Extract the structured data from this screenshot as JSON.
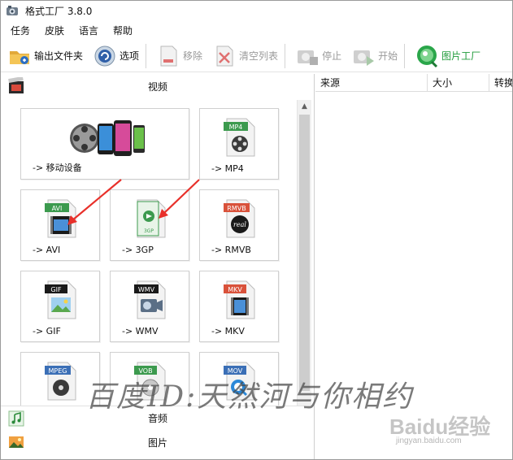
{
  "window": {
    "title": "格式工厂 3.8.0"
  },
  "menu": [
    "任务",
    "皮肤",
    "语言",
    "帮助"
  ],
  "toolbar": {
    "output_folder": "输出文件夹",
    "options": "选项",
    "remove": "移除",
    "clear_list": "清空列表",
    "stop": "停止",
    "start": "开始",
    "picture_factory": "图片工厂"
  },
  "categories": {
    "video": "视频",
    "audio": "音频",
    "picture": "图片"
  },
  "video_tiles": {
    "mobile": {
      "label": "-> 移动设备"
    },
    "mp4": {
      "label": "-> MP4",
      "badge": "MP4"
    },
    "avi": {
      "label": "-> AVI",
      "badge": "AVI"
    },
    "gp3": {
      "label": "-> 3GP",
      "badge": "3GP"
    },
    "rmvb": {
      "label": "-> RMVB",
      "badge": "RMVB",
      "sub": "real"
    },
    "gif": {
      "label": "-> GIF",
      "badge": "GIF"
    },
    "wmv": {
      "label": "-> WMV",
      "badge": "WMV"
    },
    "mkv": {
      "label": "-> MKV",
      "badge": "MKV"
    },
    "mpeg": {
      "badge": "MPEG"
    },
    "vob": {
      "badge": "VOB"
    },
    "mov": {
      "badge": "MOV"
    }
  },
  "task_list": {
    "columns": [
      "来源",
      "大小",
      "转换状"
    ]
  },
  "watermark": {
    "text": "百度ID:天然河与你相约",
    "site": "Baidu经验",
    "url": "jingyan.baidu.com"
  },
  "colors": {
    "accent_green": "#1f9b3a",
    "arrow_red": "#e8302a",
    "badge_green": "#3c9a4e",
    "badge_red": "#d9523b",
    "badge_black": "#1a1a1a",
    "badge_blue": "#3b6fb6"
  }
}
